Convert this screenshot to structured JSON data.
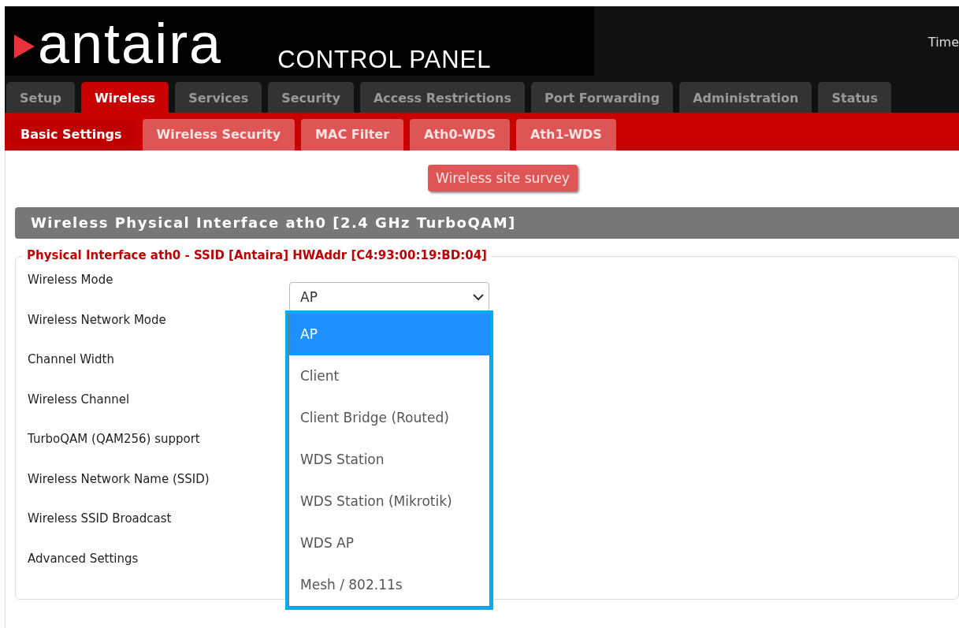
{
  "header": {
    "logo_text": "antaira",
    "subtitle": "CONTROL PANEL",
    "time_label": "Time"
  },
  "main_tabs": [
    {
      "label": "Setup",
      "selected": false
    },
    {
      "label": "Wireless",
      "selected": true
    },
    {
      "label": "Services",
      "selected": false
    },
    {
      "label": "Security",
      "selected": false
    },
    {
      "label": "Access Restrictions",
      "selected": false
    },
    {
      "label": "Port Forwarding",
      "selected": false
    },
    {
      "label": "Administration",
      "selected": false
    },
    {
      "label": "Status",
      "selected": false
    }
  ],
  "sub_tabs": [
    {
      "label": "Basic Settings",
      "selected": true
    },
    {
      "label": "Wireless Security",
      "selected": false
    },
    {
      "label": "MAC Filter",
      "selected": false
    },
    {
      "label": "Ath0-WDS",
      "selected": false
    },
    {
      "label": "Ath1-WDS",
      "selected": false
    }
  ],
  "survey_button": "Wireless site survey",
  "section_title": "Wireless Physical Interface ath0 [2.4 GHz TurboQAM]",
  "fieldset": {
    "legend": "Physical Interface ath0 - SSID [Antaira] HWAddr [C4:93:00:19:BD:04]",
    "fields": [
      {
        "label": "Wireless Mode"
      },
      {
        "label": "Wireless Network Mode"
      },
      {
        "label": "Channel Width"
      },
      {
        "label": "Wireless Channel"
      },
      {
        "label": "TurboQAM (QAM256) support"
      },
      {
        "label": "Wireless Network Name (SSID)"
      },
      {
        "label": "Wireless SSID Broadcast"
      },
      {
        "label": "Advanced Settings"
      }
    ]
  },
  "mode_select": {
    "value": "AP",
    "expanded": true,
    "options": [
      {
        "label": "AP",
        "selected": true
      },
      {
        "label": "Client",
        "selected": false
      },
      {
        "label": "Client Bridge (Routed)",
        "selected": false
      },
      {
        "label": "WDS Station",
        "selected": false
      },
      {
        "label": "WDS Station (Mikrotik)",
        "selected": false
      },
      {
        "label": "WDS AP",
        "selected": false
      },
      {
        "label": "Mesh / 802.11s",
        "selected": false
      }
    ]
  }
}
